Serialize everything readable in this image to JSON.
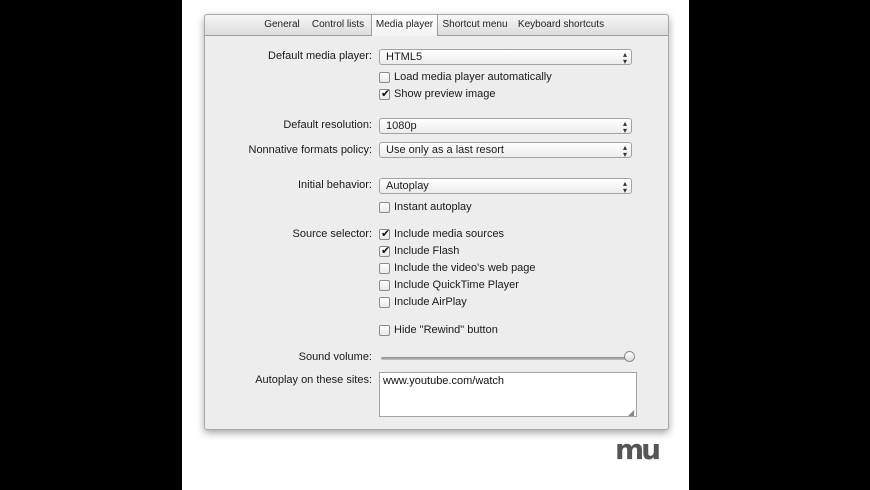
{
  "tabs": [
    {
      "label": "General",
      "selected": false
    },
    {
      "label": "Control lists",
      "selected": false
    },
    {
      "label": "Media player",
      "selected": true
    },
    {
      "label": "Shortcut menu",
      "selected": false
    },
    {
      "label": "Keyboard shortcuts",
      "selected": false
    }
  ],
  "media_player": {
    "default_player": {
      "label": "Default media player:",
      "value": "HTML5"
    },
    "load_auto": {
      "label": "Load media player automatically",
      "checked": false
    },
    "show_preview": {
      "label": "Show preview image",
      "checked": true
    },
    "resolution": {
      "label": "Default resolution:",
      "value": "1080p"
    },
    "nonnative": {
      "label": "Nonnative formats policy:",
      "value": "Use only as a last resort"
    },
    "initial_behavior": {
      "label": "Initial behavior:",
      "value": "Autoplay"
    },
    "instant_autoplay": {
      "label": "Instant autoplay",
      "checked": false
    },
    "source_selector": {
      "label": "Source selector:",
      "items": [
        {
          "label": "Include media sources",
          "checked": true
        },
        {
          "label": "Include Flash",
          "checked": true
        },
        {
          "label": "Include the video's web page",
          "checked": false
        },
        {
          "label": "Include QuickTime Player",
          "checked": false
        },
        {
          "label": "Include AirPlay",
          "checked": false
        }
      ]
    },
    "hide_rewind": {
      "label": "Hide \"Rewind\" button",
      "checked": false
    },
    "sound_volume": {
      "label": "Sound volume:",
      "value": 1.0
    },
    "autoplay_sites": {
      "label": "Autoplay on these sites:",
      "value": "www.youtube.com/watch"
    }
  },
  "watermark": "mu"
}
